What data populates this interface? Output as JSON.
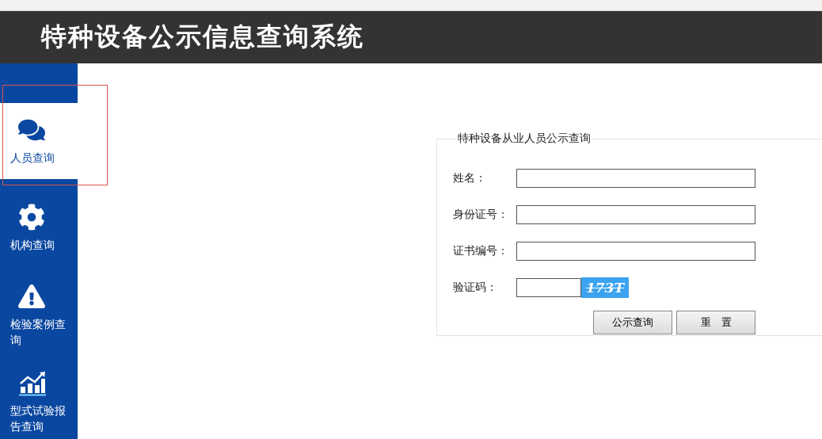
{
  "header": {
    "title": "特种设备公示信息查询系统"
  },
  "sidebar": {
    "items": [
      {
        "kind": "chat",
        "label": "人员查询",
        "selected": true
      },
      {
        "kind": "gear",
        "label": "机构查询",
        "selected": false
      },
      {
        "kind": "warning",
        "label": "检验案例查询",
        "selected": false
      },
      {
        "kind": "chart",
        "label": "型式试验报告查询",
        "selected": false
      }
    ]
  },
  "form": {
    "legend": "特种设备从业人员公示查询",
    "fields": [
      {
        "kind": "text",
        "label": "姓名："
      },
      {
        "kind": "text",
        "label": "身份证号："
      },
      {
        "kind": "text",
        "label": "证书编号："
      },
      {
        "kind": "captcha",
        "label": "验证码：",
        "captcha": "173T"
      }
    ],
    "buttons": [
      "公示查询",
      "重　置"
    ]
  }
}
